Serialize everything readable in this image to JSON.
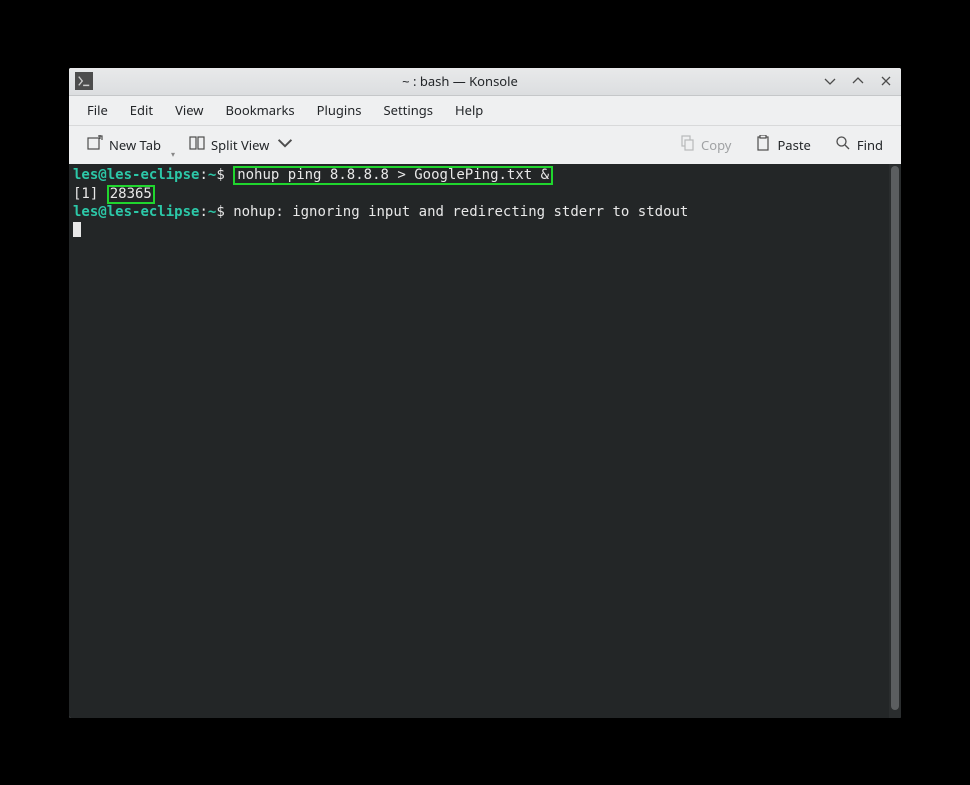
{
  "titlebar": {
    "title": "~ : bash — Konsole"
  },
  "menubar": {
    "file": "File",
    "edit": "Edit",
    "view": "View",
    "bookmarks": "Bookmarks",
    "plugins": "Plugins",
    "settings": "Settings",
    "help": "Help"
  },
  "toolbar": {
    "new_tab": "New Tab",
    "split_view": "Split View",
    "copy": "Copy",
    "paste": "Paste",
    "find": "Find"
  },
  "terminal": {
    "user": "les",
    "host": "les-eclipse",
    "path": "~",
    "prompt_sep1": "@",
    "prompt_sep2": ":",
    "prompt_char": "$",
    "command": "nohup ping 8.8.8.8 > GooglePing.txt &",
    "job_prefix": "[1] ",
    "pid": "28365",
    "nohup_msg": "nohup: ignoring input and redirecting stderr to stdout"
  }
}
